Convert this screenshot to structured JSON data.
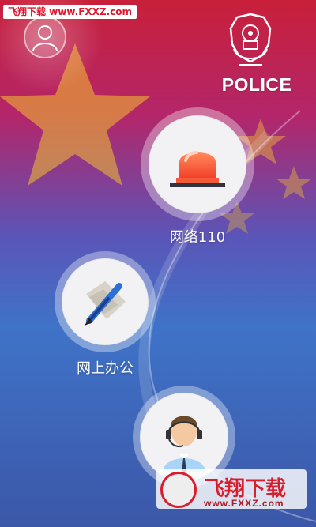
{
  "watermark_top": "飞翔下载 www.FXXZ.com",
  "header": {
    "police_label": "POLICE",
    "avatar_icon": "user-avatar-icon",
    "badge_icon": "police-emblem-icon"
  },
  "menu": {
    "items": [
      {
        "label": "网络110",
        "icon": "alarm-light-icon"
      },
      {
        "label": "网上办公",
        "icon": "pen-document-icon"
      },
      {
        "label": "",
        "icon": "customer-service-icon"
      }
    ]
  },
  "watermark_bottom": {
    "title": "飞翔下载",
    "url": "www.FXXZ.com"
  },
  "colors": {
    "flag_red": "#c8203a",
    "star_yellow": "#f2c12e",
    "background_blue": "#3f73c8",
    "siren_red": "#ff5a3a"
  }
}
